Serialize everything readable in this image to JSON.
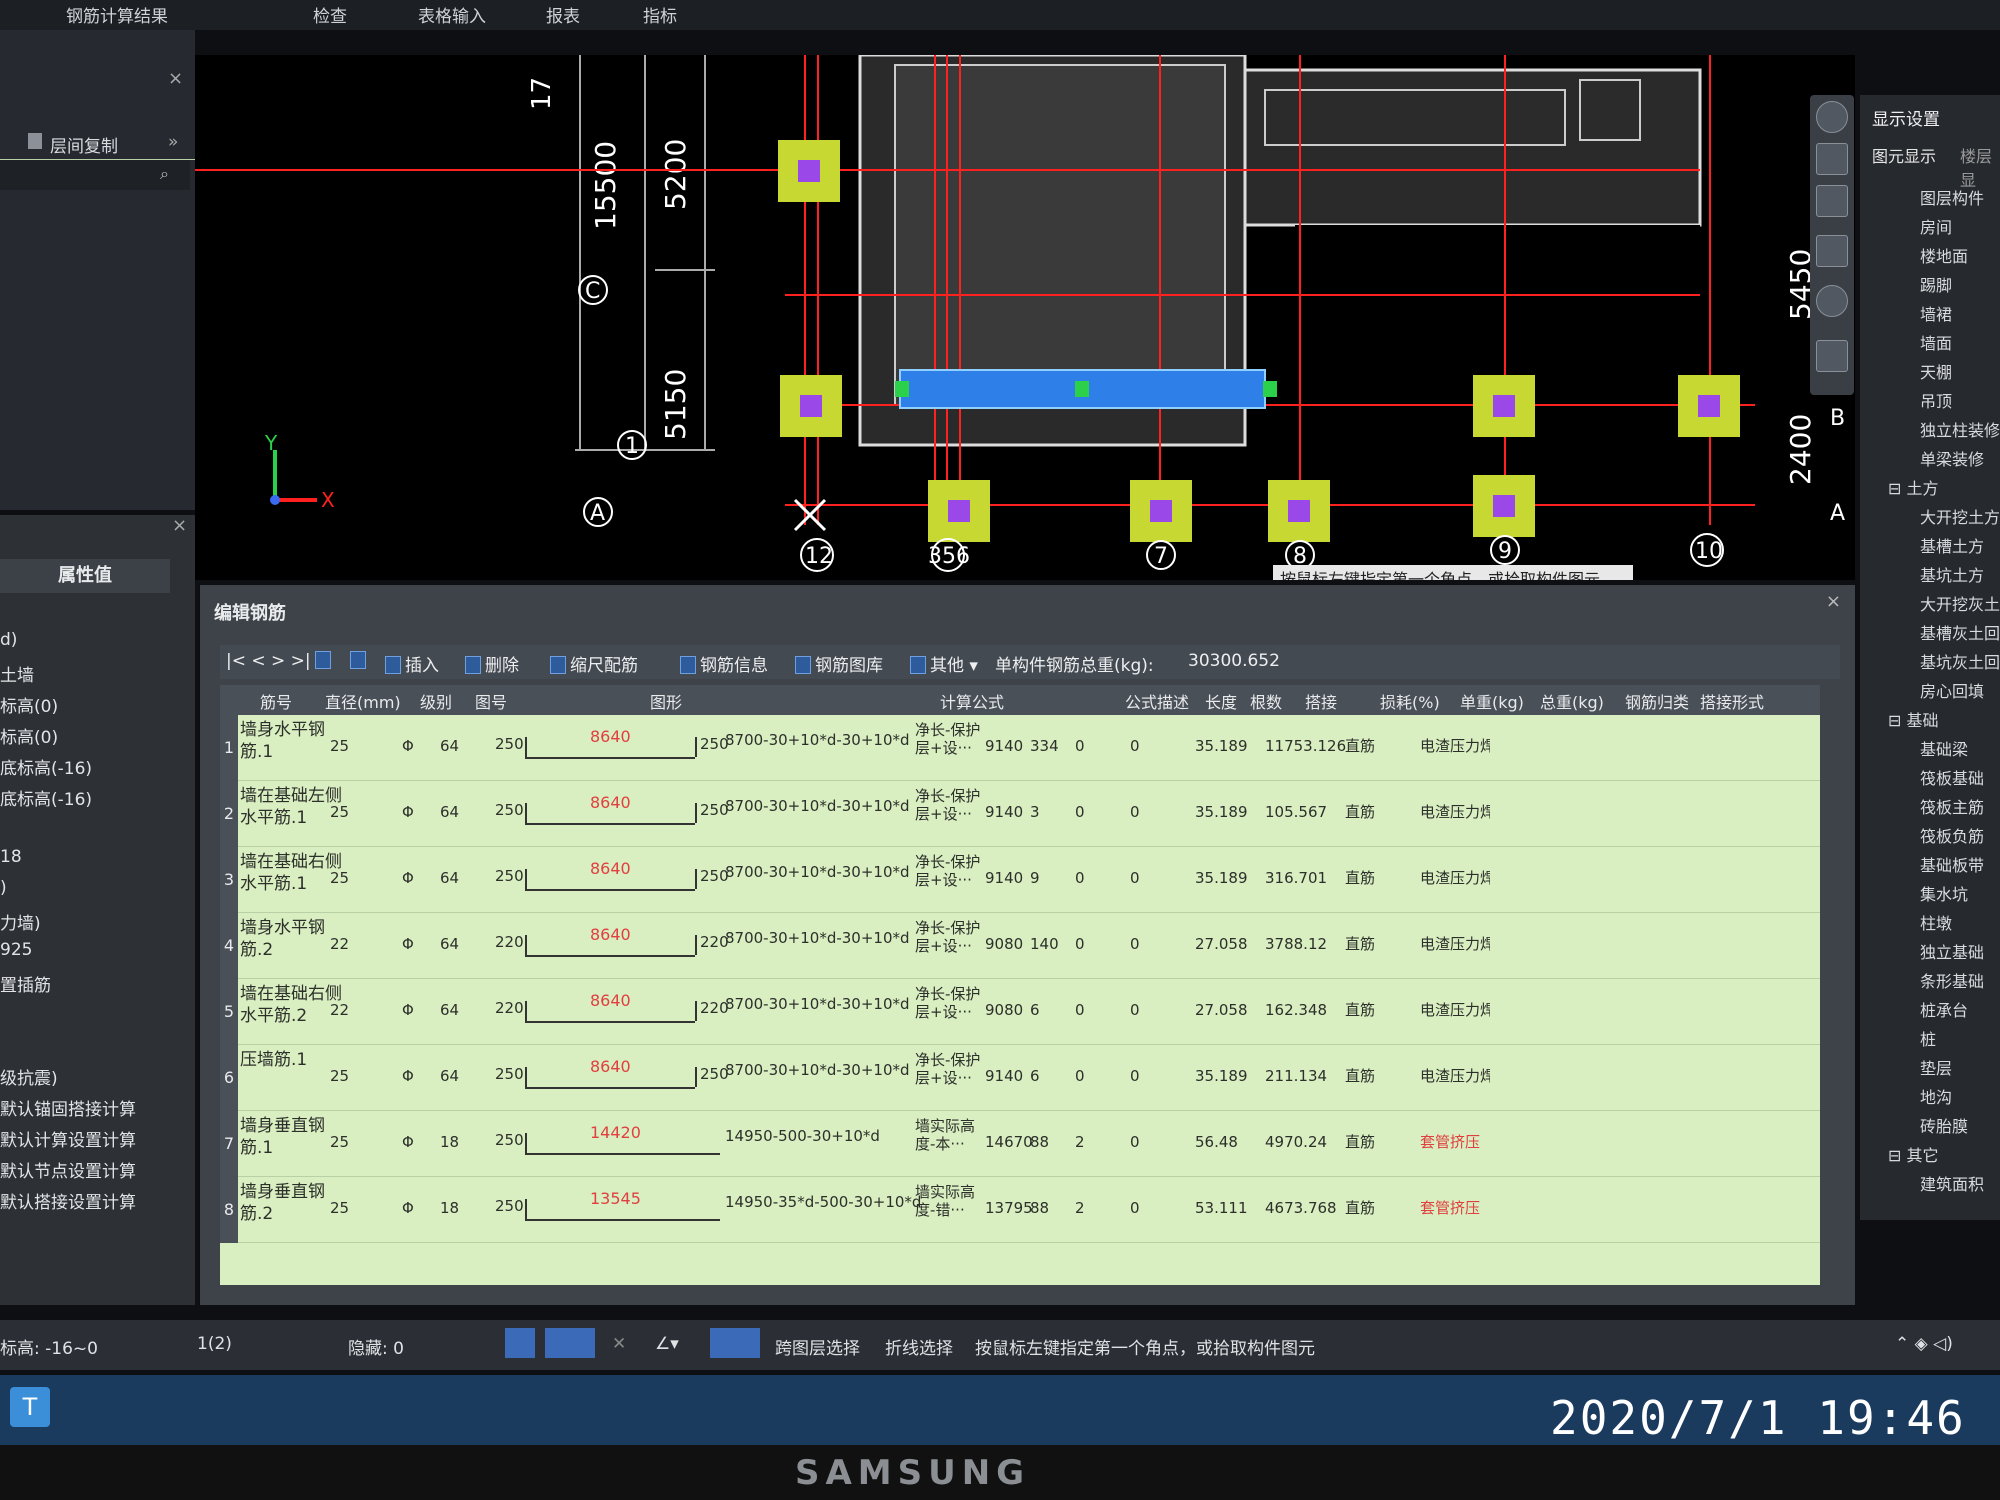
{
  "menu": [
    "钢筋计算结果",
    "检查",
    "表格输入",
    "报表",
    "指标"
  ],
  "left_top": {
    "copy_label": "层间复制",
    "close": "×"
  },
  "property_panel": {
    "header": "属性值",
    "rows": [
      "d)",
      "土墙",
      "标高(0)",
      "标高(0)",
      "底标高(-16)",
      "底标高(-16)",
      "",
      "18",
      ")",
      "力墙)",
      "925",
      "置插筋",
      "",
      "",
      "级抗震)",
      "默认锚固搭接计算",
      "默认计算设置计算",
      "默认节点设置计算",
      "默认搭接设置计算"
    ]
  },
  "cad": {
    "dimensions": [
      "15500",
      "5200",
      "5150",
      "5450",
      "2400"
    ],
    "axis_letters": [
      "C",
      "A",
      "A",
      "B"
    ],
    "axis_numbers": [
      "1",
      "12",
      "356",
      "7",
      "8",
      "9",
      "10"
    ],
    "axis_x": "X",
    "axis_y": "Y",
    "tooltip": "按鼠标左键指定第一个角点，或拾取构件图元"
  },
  "display_settings": {
    "title": "显示设置",
    "tabs": [
      "图元显示",
      "楼层显"
    ],
    "items": [
      {
        "type": "item",
        "label": "图层构件"
      },
      {
        "type": "item",
        "label": "房间"
      },
      {
        "type": "item",
        "label": "楼地面"
      },
      {
        "type": "item",
        "label": "踢脚"
      },
      {
        "type": "item",
        "label": "墙裙"
      },
      {
        "type": "item",
        "label": "墙面"
      },
      {
        "type": "item",
        "label": "天棚"
      },
      {
        "type": "item",
        "label": "吊顶"
      },
      {
        "type": "item",
        "label": "独立柱装修"
      },
      {
        "type": "item",
        "label": "单梁装修"
      },
      {
        "type": "group",
        "label": "土方"
      },
      {
        "type": "item",
        "label": "大开挖土方"
      },
      {
        "type": "item",
        "label": "基槽土方"
      },
      {
        "type": "item",
        "label": "基坑土方"
      },
      {
        "type": "item",
        "label": "大开挖灰土"
      },
      {
        "type": "item",
        "label": "基槽灰土回"
      },
      {
        "type": "item",
        "label": "基坑灰土回"
      },
      {
        "type": "item",
        "label": "房心回填"
      },
      {
        "type": "group",
        "label": "基础"
      },
      {
        "type": "item",
        "label": "基础梁"
      },
      {
        "type": "item",
        "label": "筏板基础"
      },
      {
        "type": "item",
        "label": "筏板主筋"
      },
      {
        "type": "item",
        "label": "筏板负筋"
      },
      {
        "type": "item",
        "label": "基础板带"
      },
      {
        "type": "item",
        "label": "集水坑"
      },
      {
        "type": "item",
        "label": "柱墩"
      },
      {
        "type": "item",
        "label": "独立基础"
      },
      {
        "type": "item",
        "label": "条形基础"
      },
      {
        "type": "item",
        "label": "桩承台"
      },
      {
        "type": "item",
        "label": "桩"
      },
      {
        "type": "item",
        "label": "垫层"
      },
      {
        "type": "item",
        "label": "地沟"
      },
      {
        "type": "item",
        "label": "砖胎膜"
      },
      {
        "type": "group",
        "label": "其它"
      },
      {
        "type": "item",
        "label": "建筑面积"
      }
    ]
  },
  "editor": {
    "title": "编辑钢筋",
    "close": "×",
    "toolbar": {
      "nav": "|< < > >|",
      "insert": "插入",
      "delete": "删除",
      "scale": "缩尺配筋",
      "info": "钢筋信息",
      "library": "钢筋图库",
      "other": "其他",
      "total_label": "单构件钢筋总重(kg):",
      "total_value": "30300.652"
    },
    "columns": [
      "筋号",
      "直径(mm)",
      "级别",
      "图号",
      "图形",
      "计算公式",
      "公式描述",
      "长度",
      "根数",
      "搭接",
      "损耗(%)",
      "单重(kg)",
      "总重(kg)",
      "钢筋归类",
      "搭接形式"
    ],
    "rows": [
      {
        "no": "1",
        "name": "墙身水平钢筋.1",
        "dia": "25",
        "grade": "Φ",
        "fig": "64",
        "hookL": "250",
        "len_shape": "8640",
        "hookR": "250",
        "formula": "8700-30+10*d-30+10*d",
        "desc": "净长-保护层+设···",
        "length": "9140",
        "count": "334",
        "lap": "0",
        "loss": "0",
        "unit_wt": "35.189",
        "total_wt": "11753.126",
        "category": "直筋",
        "lap_type": "电渣压力焊",
        "shape": "bent"
      },
      {
        "no": "2",
        "name": "墙在基础左侧水平筋.1",
        "dia": "25",
        "grade": "Φ",
        "fig": "64",
        "hookL": "250",
        "len_shape": "8640",
        "hookR": "250",
        "formula": "8700-30+10*d-30+10*d",
        "desc": "净长-保护层+设···",
        "length": "9140",
        "count": "3",
        "lap": "0",
        "loss": "0",
        "unit_wt": "35.189",
        "total_wt": "105.567",
        "category": "直筋",
        "lap_type": "电渣压力焊",
        "shape": "bent"
      },
      {
        "no": "3",
        "name": "墙在基础右侧水平筋.1",
        "dia": "25",
        "grade": "Φ",
        "fig": "64",
        "hookL": "250",
        "len_shape": "8640",
        "hookR": "250",
        "formula": "8700-30+10*d-30+10*d",
        "desc": "净长-保护层+设···",
        "length": "9140",
        "count": "9",
        "lap": "0",
        "loss": "0",
        "unit_wt": "35.189",
        "total_wt": "316.701",
        "category": "直筋",
        "lap_type": "电渣压力焊",
        "shape": "bent"
      },
      {
        "no": "4",
        "name": "墙身水平钢筋.2",
        "dia": "22",
        "grade": "Φ",
        "fig": "64",
        "hookL": "220",
        "len_shape": "8640",
        "hookR": "220",
        "formula": "8700-30+10*d-30+10*d",
        "desc": "净长-保护层+设···",
        "length": "9080",
        "count": "140",
        "lap": "0",
        "loss": "0",
        "unit_wt": "27.058",
        "total_wt": "3788.12",
        "category": "直筋",
        "lap_type": "电渣压力焊",
        "shape": "bent"
      },
      {
        "no": "5",
        "name": "墙在基础右侧水平筋.2",
        "dia": "22",
        "grade": "Φ",
        "fig": "64",
        "hookL": "220",
        "len_shape": "8640",
        "hookR": "220",
        "formula": "8700-30+10*d-30+10*d",
        "desc": "净长-保护层+设···",
        "length": "9080",
        "count": "6",
        "lap": "0",
        "loss": "0",
        "unit_wt": "27.058",
        "total_wt": "162.348",
        "category": "直筋",
        "lap_type": "电渣压力焊",
        "shape": "bent"
      },
      {
        "no": "6",
        "name": "压墙筋.1",
        "dia": "25",
        "grade": "Φ",
        "fig": "64",
        "hookL": "250",
        "len_shape": "8640",
        "hookR": "250",
        "formula": "8700-30+10*d-30+10*d",
        "desc": "净长-保护层+设···",
        "length": "9140",
        "count": "6",
        "lap": "0",
        "loss": "0",
        "unit_wt": "35.189",
        "total_wt": "211.134",
        "category": "直筋",
        "lap_type": "电渣压力焊",
        "shape": "bent"
      },
      {
        "no": "7",
        "name": "墙身垂直钢筋.1",
        "dia": "25",
        "grade": "Φ",
        "fig": "18",
        "hookL": "250",
        "len_shape": "14420",
        "hookR": "",
        "formula": "14950-500-30+10*d",
        "desc": "墙实际高度-本···",
        "length": "14670",
        "count": "88",
        "lap": "2",
        "loss": "0",
        "unit_wt": "56.48",
        "total_wt": "4970.24",
        "category": "直筋",
        "lap_type": "套管挤压",
        "shape": "L"
      },
      {
        "no": "8",
        "name": "墙身垂直钢筋.2",
        "dia": "25",
        "grade": "Φ",
        "fig": "18",
        "hookL": "250",
        "len_shape": "13545",
        "hookR": "",
        "formula": "14950-35*d-500-30+10*d",
        "desc": "墙实际高度-错···",
        "length": "13795",
        "count": "88",
        "lap": "2",
        "loss": "0",
        "unit_wt": "53.111",
        "total_wt": "4673.768",
        "category": "直筋",
        "lap_type": "套管挤压",
        "shape": "L"
      }
    ]
  },
  "statusbar": {
    "elevation": "标高: -16~0",
    "layer": "1(2)",
    "hidden": "隐藏: 0",
    "cross_layer": "跨图层选择",
    "polyline": "折线选择",
    "prompt": "按鼠标左键指定第一个角点，或拾取构件图元"
  },
  "taskbar": {
    "datetime": "2020/7/1  19:46"
  },
  "monitor_brand": "SAMSUNG",
  "colors": {
    "grid_bg": "#d9eec1",
    "cad_bg": "#000000",
    "axis_red": "#ff2020",
    "column_yellow": "#c8d832",
    "column_core": "#9a48e8",
    "wall_blue": "#2f7fe8"
  }
}
